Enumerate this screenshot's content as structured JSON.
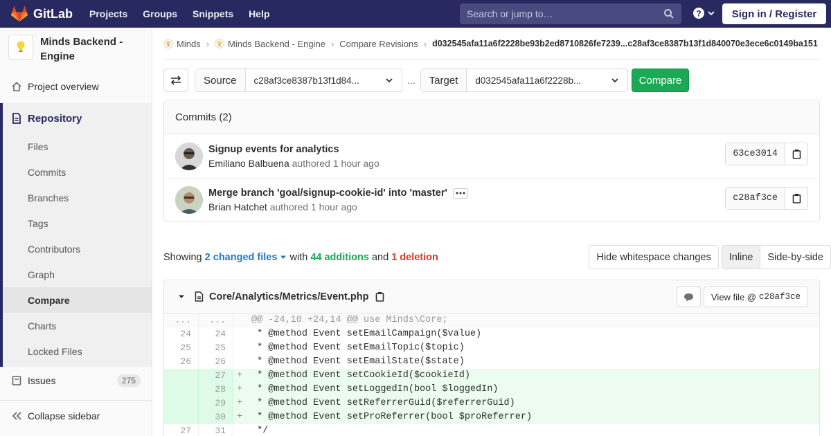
{
  "topbar": {
    "brand": "GitLab",
    "nav": [
      "Projects",
      "Groups",
      "Snippets",
      "Help"
    ],
    "search_placeholder": "Search or jump to…",
    "signin": "Sign in / Register"
  },
  "sidebar": {
    "project_name": "Minds Backend - Engine",
    "overview": "Project overview",
    "repository": "Repository",
    "repo_items": [
      "Files",
      "Commits",
      "Branches",
      "Tags",
      "Contributors",
      "Graph",
      "Compare",
      "Charts",
      "Locked Files"
    ],
    "issues": "Issues",
    "issues_count": "275",
    "collapse": "Collapse sidebar"
  },
  "breadcrumb": {
    "items": [
      "Minds",
      "Minds Backend - Engine",
      "Compare Revisions"
    ],
    "current": "d032545afa11a6f2228be93b2ed8710826fe7239...c28af3ce8387b13f1d840070e3ece6c0149ba151"
  },
  "compare": {
    "source_label": "Source",
    "source_value": "c28af3ce8387b13f1d84...",
    "separator": "...",
    "target_label": "Target",
    "target_value": "d032545afa11a6f2228b...",
    "button": "Compare"
  },
  "commits": {
    "header": "Commits (2)",
    "items": [
      {
        "title": "Signup events for analytics",
        "author": "Emiliano Balbuena",
        "verb": "authored",
        "time": "1 hour ago",
        "sha": "63ce3014"
      },
      {
        "title": "Merge branch 'goal/signup-cookie-id' into 'master'",
        "author": "Brian Hatchet",
        "verb": "authored",
        "time": "1 hour ago",
        "sha": "c28af3ce"
      }
    ]
  },
  "summary": {
    "showing": "Showing",
    "files": "2 changed files",
    "with": "with",
    "additions": "44 additions",
    "and": "and",
    "deletions": "1 deletion",
    "whitespace_btn": "Hide whitespace changes",
    "inline_btn": "Inline",
    "side_btn": "Side-by-side"
  },
  "file": {
    "path": "Core/Analytics/Metrics/Event.php",
    "view_file_label": "View file @",
    "view_file_sha": "c28af3ce",
    "lines": [
      {
        "type": "match",
        "old": "...",
        "new": "...",
        "marker": "",
        "code": "@@ -24,10 +24,14 @@ use Minds\\Core;"
      },
      {
        "type": "ctx",
        "old": "24",
        "new": "24",
        "marker": "",
        "code": " * @method Event setEmailCampaign($value)"
      },
      {
        "type": "ctx",
        "old": "25",
        "new": "25",
        "marker": "",
        "code": " * @method Event setEmailTopic($topic)"
      },
      {
        "type": "ctx",
        "old": "26",
        "new": "26",
        "marker": "",
        "code": " * @method Event setEmailState($state)"
      },
      {
        "type": "add",
        "old": "",
        "new": "27",
        "marker": "+",
        "code": " * @method Event setCookieId($cookieId)"
      },
      {
        "type": "add",
        "old": "",
        "new": "28",
        "marker": "+",
        "code": " * @method Event setLoggedIn(bool $loggedIn)"
      },
      {
        "type": "add",
        "old": "",
        "new": "29",
        "marker": "+",
        "code": " * @method Event setReferrerGuid($referrerGuid)"
      },
      {
        "type": "add",
        "old": "",
        "new": "30",
        "marker": "+",
        "code": " * @method Event setProReferrer(bool $proReferrer)"
      },
      {
        "type": "ctx",
        "old": "27",
        "new": "31",
        "marker": "",
        "code": " */"
      }
    ]
  }
}
